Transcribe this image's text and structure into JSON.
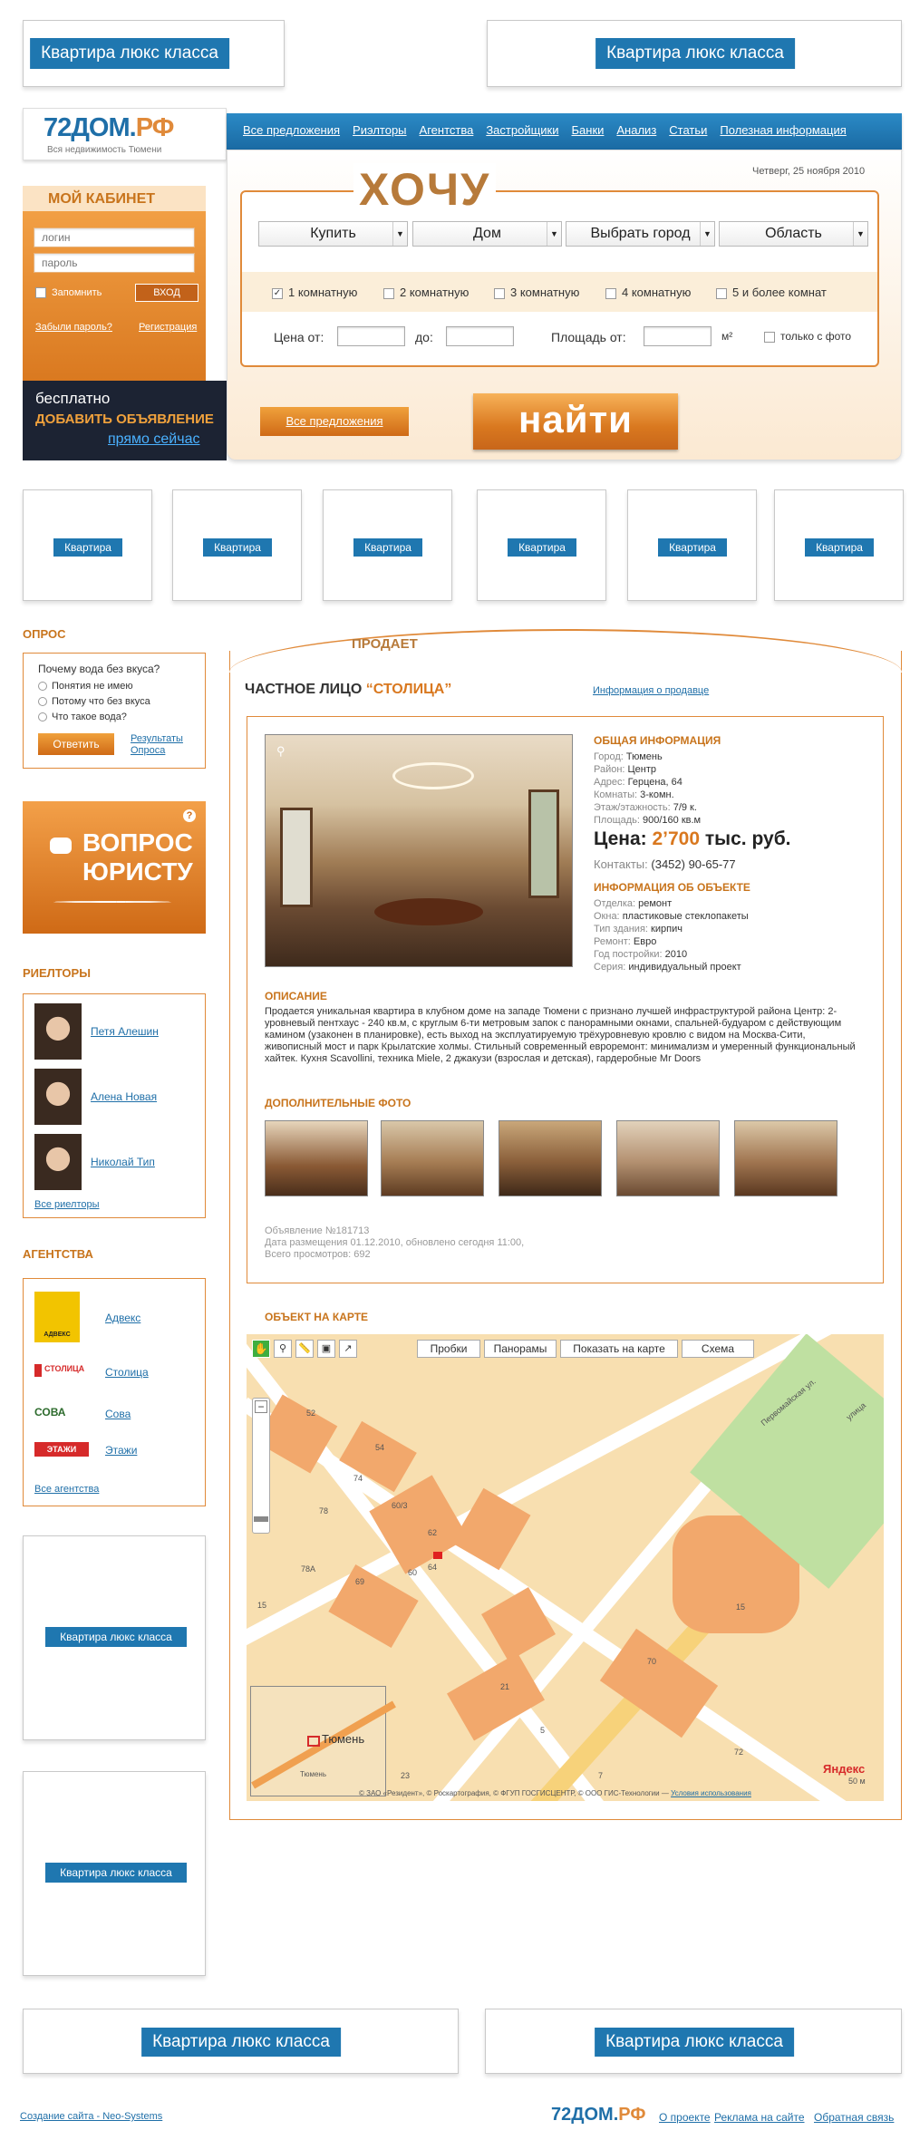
{
  "ad_label": "Квартира люкс класса",
  "ad_small_label": "Квартира",
  "logo": {
    "text": "72ДОМ.",
    "suffix": "РФ",
    "tagline": "Вся недвижимость Тюмени"
  },
  "nav": [
    "Все предложения",
    "Риэлторы",
    "Агентства",
    "Застройщики",
    "Банки",
    "Анализ",
    "Статьи",
    "Полезная информация"
  ],
  "date": "Четверг, 25 ноября 2010",
  "cabinet": {
    "title": "МОЙ КАБИНЕТ",
    "login_ph": "логин",
    "pass_ph": "пароль",
    "remember": "Запомнить",
    "enter": "ВХОД",
    "forgot": "Забыли пароль?",
    "register": "Регистрация"
  },
  "promo": {
    "free": "бесплатно",
    "add": "ДОБАВИТЬ ОБЪЯВЛЕНИЕ",
    "now": "прямо сейчас"
  },
  "search": {
    "want": "ХОЧУ",
    "selects": [
      "Купить",
      "Дом",
      "Выбрать город",
      "Область"
    ],
    "rooms": [
      "1 комнатную",
      "2 комнатную",
      "3 комнатную",
      "4 комнатную",
      "5 и более комнат"
    ],
    "price_from": "Цена от:",
    "price_to": "до:",
    "area_from": "Площадь от:",
    "unit": "м²",
    "photo_only": "только с фото",
    "all_offers": "Все предложения",
    "find": "найти"
  },
  "poll": {
    "title": "ОПРОС",
    "question": "Почему вода без вкуса?",
    "options": [
      "Понятия не имею",
      "Потому что без вкуса",
      "Что такое вода?"
    ],
    "answer": "Ответить",
    "results": "Результаты Опроса"
  },
  "lawyer": {
    "line1": "ВОПРОС",
    "line2": "ЮРИСТУ",
    "q": "?"
  },
  "realtors": {
    "title": "РИЕЛТОРЫ",
    "items": [
      "Петя Алешин",
      "Алена Новая",
      "Николай Тип"
    ],
    "all": "Все риелторы"
  },
  "agencies": {
    "title": "АГЕНТСТВА",
    "items": [
      "Адвекс",
      "Столица",
      "Сова",
      "Этажи"
    ],
    "logos": [
      "АДВЕКС",
      "СТОЛИЦА",
      "СОВА",
      "ЭТАЖИ"
    ],
    "all": "Все агентства"
  },
  "listing": {
    "tab": "ПРОДАЕТ",
    "seller_prefix": "ЧАСТНОЕ ЛИЦО",
    "seller_name": "“СТОЛИЦА”",
    "seller_info": "Информация о продавце",
    "general_title": "ОБЩАЯ ИНФОРМАЦИЯ",
    "general": [
      [
        "Город:",
        "Тюмень"
      ],
      [
        "Район:",
        "Центр"
      ],
      [
        "Адрес:",
        "Герцена, 64"
      ],
      [
        "Комнаты:",
        "3-комн."
      ],
      [
        "Этаж/этажность:",
        "7/9 к."
      ],
      [
        "Площадь:",
        "900/160 кв.м"
      ]
    ],
    "price_label": "Цена:",
    "price_value": "2’700",
    "price_unit": "тыс. руб.",
    "contacts_label": "Контакты:",
    "contacts_value": "(3452) 90-65-77",
    "object_title": "ИНФОРМАЦИЯ ОБ ОБЪЕКТЕ",
    "object": [
      [
        "Отделка:",
        "ремонт"
      ],
      [
        "Окна:",
        "пластиковые стеклопакеты"
      ],
      [
        "Тип здания:",
        "кирпич"
      ],
      [
        "Ремонт:",
        "Евро"
      ],
      [
        "Год постройки:",
        "2010"
      ],
      [
        "Серия:",
        "индивидуальный проект"
      ]
    ],
    "desc_title": "ОПИСАНИЕ",
    "desc": "Продается уникальная квартира в клубном доме на западе Тюмени с признано лучшей инфраструктурой района Центр: 2-уровневый пентхаус - 240 кв.м, с круглым 6-ти метровым запок с панорамными окнами, спальней-будуаром с действующим камином (узаконен в планировке), есть выход на эксплуатируемую трёхуровневую кровлю с видом на Москва-Сити, живописный мост и парк Крылатские холмы. Стильный современный евроремонт: минимализм и умеренный функциональный хайтек. Кухня Scavollini, техника Miele, 2 джакузи (взрослая и детская), гардеробные Mr Doors",
    "photos_title": "ДОПОЛНИТЕЛЬНЫЕ ФОТО",
    "meta1": "Объявление №181713",
    "meta2": "Дата размещения 01.12.2010,  обновлено сегодня 11:00,",
    "meta3": "Всего просмотров: 692",
    "map_title": "ОБЪЕКТ НА КАРТЕ"
  },
  "map": {
    "traffic": "Пробки",
    "panoramas": "Панорамы",
    "show": "Показать на карте",
    "scheme": "Схема",
    "city": "Тюмень",
    "mini_city": "Тюмень",
    "scale": "50 м",
    "brand": "Яндекс",
    "copyright": "© ЗАО «Резидент», © Роскартография, © ФГУП ГОСГИСЦЕНТР, © ООО ГИС-Технологии —",
    "terms": "Условия использования",
    "street1": "Первомайская ул.",
    "street2": "улица",
    "numbers": [
      "52",
      "54",
      "74",
      "60/3",
      "62",
      "78",
      "60",
      "64",
      "69",
      "78А",
      "15",
      "15",
      "70",
      "21",
      "5",
      "72",
      "23",
      "7"
    ]
  },
  "footer": {
    "made": "Создание сайта - Neo-Systems",
    "logo": "72ДОМ.",
    "suffix": "РФ",
    "links": [
      "О проекте",
      "Реклама на сайте",
      "Обратная связь"
    ]
  },
  "colors": {
    "orange": "#d9781f",
    "blue": "#1f6fa8",
    "navy": "#1c2333"
  }
}
